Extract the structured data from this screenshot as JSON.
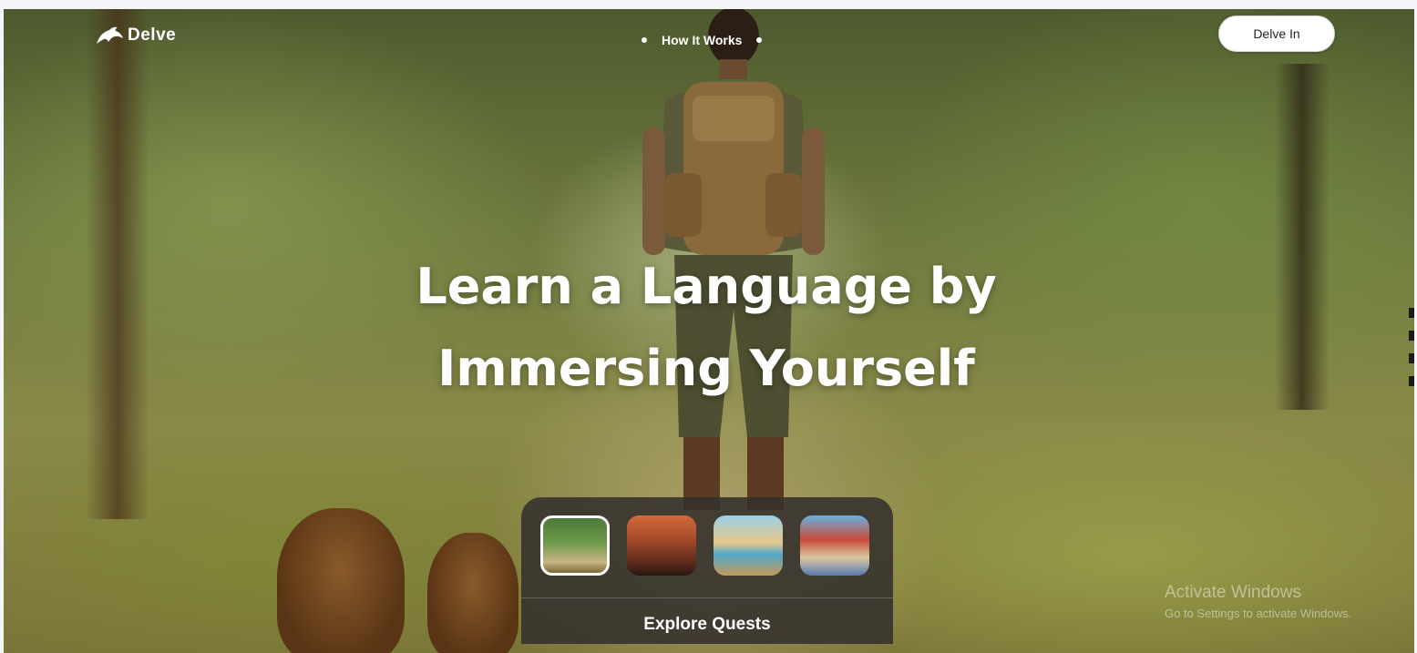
{
  "header": {
    "brand": "Delve",
    "logo_icon": "dolphin-icon",
    "nav_link": "How It Works",
    "cta_label": "Delve In"
  },
  "hero": {
    "headline_line1": "Learn a Language by",
    "headline_line2": "Immersing Yourself",
    "background_icon": "jungle-explorer-scene"
  },
  "quests": {
    "thumbnails": [
      {
        "scene": "jungle-trail",
        "active": true
      },
      {
        "scene": "burning-city",
        "active": false
      },
      {
        "scene": "desert-oasis",
        "active": false
      },
      {
        "scene": "city-street",
        "active": false
      }
    ],
    "explore_label": "Explore Quests"
  },
  "watermark": {
    "title": "Activate Windows",
    "subtitle": "Go to Settings to activate Windows."
  },
  "colors": {
    "text_light": "#ffffff",
    "button_bg": "#ffffff",
    "panel_bg": "#34302c"
  }
}
